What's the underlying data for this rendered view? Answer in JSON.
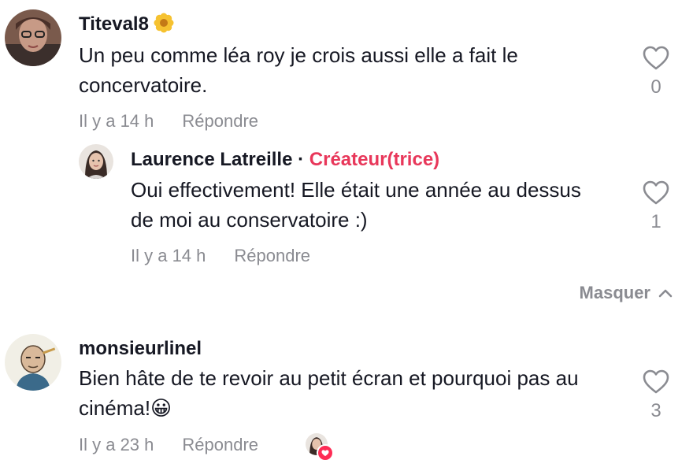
{
  "comments": [
    {
      "username": "Titeval8",
      "badge_icon": "flower-emoji",
      "text": "Un peu comme léa roy je crois aussi elle a fait le concervatoire.",
      "time": "Il y a 14 h",
      "reply_label": "Répondre",
      "likes": "0",
      "reply": {
        "username": "Laurence Latreille",
        "separator": "·",
        "creator_label": "Créateur(trice)",
        "text": "Oui effectivement! Elle était une année au dessus de moi au conservatoire :)",
        "time": "Il y a 14 h",
        "reply_label": "Répondre",
        "likes": "1"
      }
    },
    {
      "username": "monsieurlinel",
      "text": "Bien hâte de te revoir au petit écran et pourquoi pas au cinéma!",
      "emoji": "😀",
      "time": "Il y a 23 h",
      "reply_label": "Répondre",
      "likes": "3",
      "liked_by_creator": true
    }
  ],
  "hide_replies_label": "Masquer",
  "colors": {
    "creator_accent": "#e8375a",
    "meta_gray": "#8a8b91",
    "text": "#161823",
    "like_badge": "#fe2c55"
  }
}
